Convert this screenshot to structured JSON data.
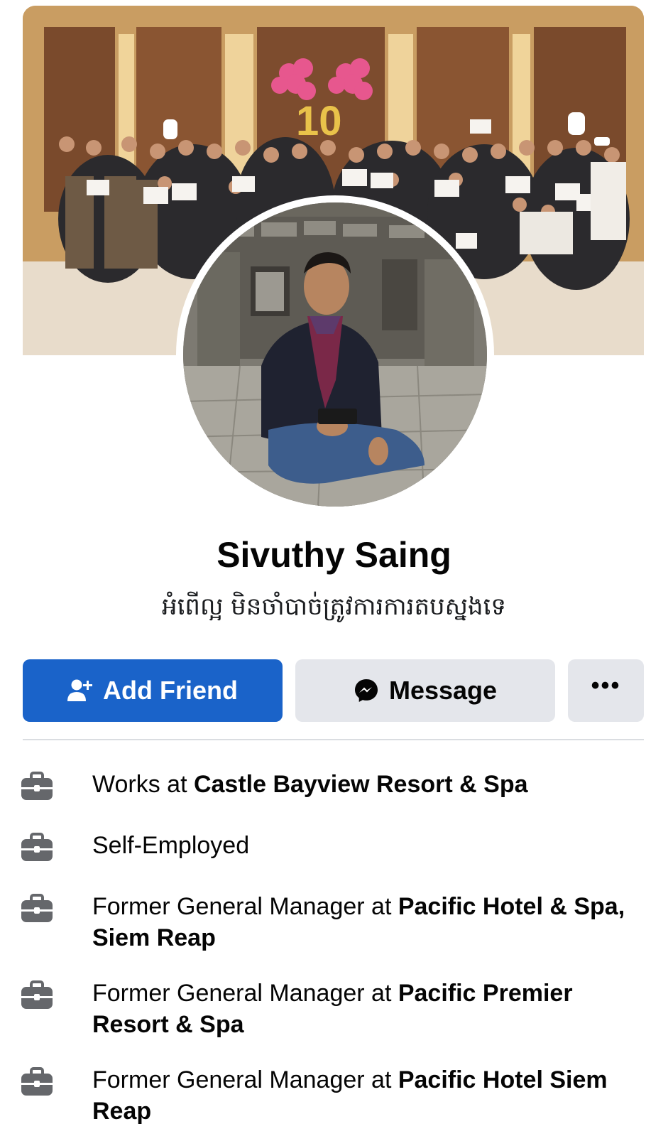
{
  "profile": {
    "name": "Sivuthy Saing",
    "bio": "អំពើល្អ មិនចាំបាច់ត្រូវការការតបស្នងទេ"
  },
  "actions": {
    "add_friend_label": "Add Friend",
    "message_label": "Message",
    "more_label": "•••"
  },
  "cover": {
    "balloon_text": "10"
  },
  "work": [
    {
      "prefix": "Works at ",
      "place": "Castle Bayview Resort & Spa"
    },
    {
      "prefix": "Self-Employed",
      "place": ""
    },
    {
      "prefix": "Former General Manager at ",
      "place": "Pacific Hotel & Spa, Siem Reap"
    },
    {
      "prefix": "Former General Manager at ",
      "place": "Pacific Premier Resort & Spa"
    },
    {
      "prefix": "Former General Manager at ",
      "place": "Pacific Hotel Siem Reap"
    }
  ],
  "colors": {
    "primary_button": "#1a63c9",
    "secondary_button": "#e4e6eb",
    "text": "#050505",
    "icon": "#65676b"
  },
  "icons": {
    "add_friend": "person-add-icon",
    "message": "messenger-icon",
    "more": "more-icon",
    "work": "briefcase-icon"
  }
}
